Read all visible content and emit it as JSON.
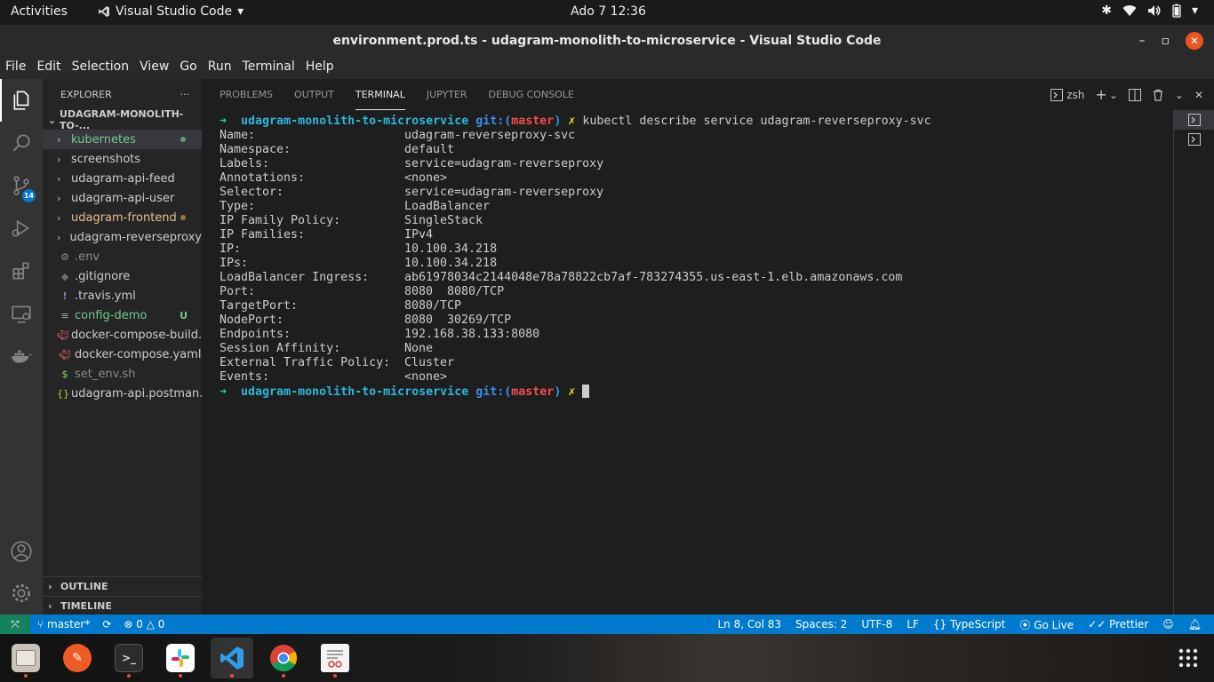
{
  "topbar": {
    "activities": "Activities",
    "app_name": "Visual Studio Code",
    "clock": "Ado 7  12:36"
  },
  "window": {
    "title": "environment.prod.ts - udagram-monolith-to-microservice - Visual Studio Code"
  },
  "menu": [
    "File",
    "Edit",
    "Selection",
    "View",
    "Go",
    "Run",
    "Terminal",
    "Help"
  ],
  "activitybar": {
    "scm_badge": "14"
  },
  "explorer": {
    "title": "EXPLORER",
    "more": "···",
    "root": "UDAGRAM-MONOLITH-TO-...",
    "items": [
      {
        "label": "kubernetes",
        "color": "#73c991"
      },
      {
        "label": "screenshots",
        "color": "#cccccc"
      },
      {
        "label": "udagram-api-feed",
        "color": "#cccccc"
      },
      {
        "label": "udagram-api-user",
        "color": "#cccccc"
      },
      {
        "label": "udagram-frontend",
        "color": "#e2c08d"
      },
      {
        "label": "udagram-reverseproxy",
        "color": "#cccccc"
      },
      {
        "label": ".env",
        "color": "#8c8c8c"
      },
      {
        "label": ".gitignore",
        "color": "#cccccc"
      },
      {
        "label": ".travis.yml",
        "color": "#cccccc"
      },
      {
        "label": "config-demo",
        "color": "#73c991",
        "status": "U"
      },
      {
        "label": "docker-compose-build...",
        "color": "#cccccc"
      },
      {
        "label": "docker-compose.yaml",
        "color": "#cccccc"
      },
      {
        "label": "set_env.sh",
        "color": "#8c8c8c"
      },
      {
        "label": "udagram-api.postman...",
        "color": "#cccccc"
      }
    ],
    "outline": "OUTLINE",
    "timeline": "TIMELINE"
  },
  "panel": {
    "tabs": [
      "PROBLEMS",
      "OUTPUT",
      "TERMINAL",
      "JUPYTER",
      "DEBUG CONSOLE"
    ],
    "shell": "zsh"
  },
  "terminal": {
    "arrow": "➜",
    "dir": "udagram-monolith-to-microservice",
    "git": "git:(",
    "branch": "master",
    "git_close": ")",
    "x": "✗",
    "command": "kubectl describe service udagram-reverseproxy-svc",
    "fields": [
      {
        "key": "Name:",
        "value": "udagram-reverseproxy-svc"
      },
      {
        "key": "Namespace:",
        "value": "default"
      },
      {
        "key": "Labels:",
        "value": "service=udagram-reverseproxy"
      },
      {
        "key": "Annotations:",
        "value": "<none>"
      },
      {
        "key": "Selector:",
        "value": "service=udagram-reverseproxy"
      },
      {
        "key": "Type:",
        "value": "LoadBalancer"
      },
      {
        "key": "IP Family Policy:",
        "value": "SingleStack"
      },
      {
        "key": "IP Families:",
        "value": "IPv4"
      },
      {
        "key": "IP:",
        "value": "10.100.34.218"
      },
      {
        "key": "IPs:",
        "value": "10.100.34.218"
      },
      {
        "key": "LoadBalancer Ingress:",
        "value": "ab61978034c2144048e78a78822cb7af-783274355.us-east-1.elb.amazonaws.com"
      },
      {
        "key": "Port:",
        "value": "8080  8080/TCP"
      },
      {
        "key": "TargetPort:",
        "value": "8080/TCP"
      },
      {
        "key": "NodePort:",
        "value": "8080  30269/TCP"
      },
      {
        "key": "Endpoints:",
        "value": "192.168.38.133:8080"
      },
      {
        "key": "Session Affinity:",
        "value": "None"
      },
      {
        "key": "External Traffic Policy:",
        "value": "Cluster"
      },
      {
        "key": "Events:",
        "value": "<none>"
      }
    ]
  },
  "statusbar": {
    "branch": "master*",
    "errors": "0",
    "warnings": "0",
    "position": "Ln 8, Col 83",
    "spaces": "Spaces: 2",
    "encoding": "UTF-8",
    "eol": "LF",
    "language": "TypeScript",
    "golive": "Go Live",
    "prettier": "Prettier"
  },
  "dock": [
    "files",
    "postman",
    "terminal",
    "slack",
    "vscode",
    "chrome",
    "text-editor"
  ]
}
